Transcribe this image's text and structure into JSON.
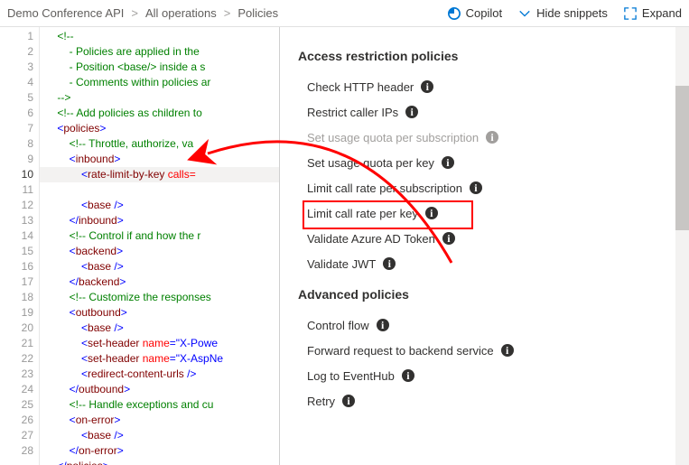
{
  "breadcrumb": {
    "a": "Demo Conference API",
    "b": "All operations",
    "c": "Policies",
    "sep": ">"
  },
  "actions": {
    "copilot": "Copilot",
    "hide": "Hide snippets",
    "expand": "Expand"
  },
  "code_lines": [
    {
      "n": "1",
      "indent": 1,
      "parts": [
        {
          "c": "t-cmt",
          "t": "<!--"
        }
      ]
    },
    {
      "n": "2",
      "indent": 2,
      "parts": [
        {
          "c": "t-cmt",
          "t": "- Policies are applied in the"
        }
      ]
    },
    {
      "n": "3",
      "indent": 2,
      "parts": [
        {
          "c": "t-cmt",
          "t": "- Position <base/> inside a s"
        }
      ]
    },
    {
      "n": "4",
      "indent": 2,
      "parts": [
        {
          "c": "t-cmt",
          "t": "- Comments within policies ar"
        }
      ]
    },
    {
      "n": "5",
      "indent": 1,
      "parts": [
        {
          "c": "t-cmt",
          "t": "-->"
        }
      ]
    },
    {
      "n": "6",
      "indent": 1,
      "parts": [
        {
          "c": "t-cmt",
          "t": "<!-- Add policies as children to"
        }
      ]
    },
    {
      "n": "7",
      "indent": 1,
      "parts": [
        {
          "c": "t-punc",
          "t": "<"
        },
        {
          "c": "t-tag",
          "t": "policies"
        },
        {
          "c": "t-punc",
          "t": ">"
        }
      ]
    },
    {
      "n": "8",
      "indent": 2,
      "parts": [
        {
          "c": "t-cmt",
          "t": "<!-- Throttle, authorize, va"
        }
      ]
    },
    {
      "n": "9",
      "indent": 2,
      "parts": [
        {
          "c": "t-punc",
          "t": "<"
        },
        {
          "c": "t-tag",
          "t": "inbound"
        },
        {
          "c": "t-punc",
          "t": ">"
        }
      ]
    },
    {
      "n": "10",
      "cur": true,
      "indent": 3,
      "parts": [
        {
          "c": "t-punc",
          "t": "<"
        },
        {
          "c": "t-tag",
          "t": "rate-limit-by-key"
        },
        {
          "c": "",
          "t": " "
        },
        {
          "c": "t-attr",
          "t": "calls="
        }
      ]
    },
    {
      "n": "11",
      "indent": 3,
      "parts": [
        {
          "c": "t-punc",
          "t": "<"
        },
        {
          "c": "t-tag",
          "t": "base"
        },
        {
          "c": "",
          "t": " "
        },
        {
          "c": "t-punc",
          "t": "/>"
        }
      ]
    },
    {
      "n": "12",
      "indent": 2,
      "parts": [
        {
          "c": "t-punc",
          "t": "</"
        },
        {
          "c": "t-tag",
          "t": "inbound"
        },
        {
          "c": "t-punc",
          "t": ">"
        }
      ]
    },
    {
      "n": "13",
      "indent": 2,
      "parts": [
        {
          "c": "t-cmt",
          "t": "<!-- Control if and how the r"
        }
      ]
    },
    {
      "n": "14",
      "indent": 2,
      "parts": [
        {
          "c": "t-punc",
          "t": "<"
        },
        {
          "c": "t-tag",
          "t": "backend"
        },
        {
          "c": "t-punc",
          "t": ">"
        }
      ]
    },
    {
      "n": "15",
      "indent": 3,
      "parts": [
        {
          "c": "t-punc",
          "t": "<"
        },
        {
          "c": "t-tag",
          "t": "base"
        },
        {
          "c": "",
          "t": " "
        },
        {
          "c": "t-punc",
          "t": "/>"
        }
      ]
    },
    {
      "n": "16",
      "indent": 2,
      "parts": [
        {
          "c": "t-punc",
          "t": "</"
        },
        {
          "c": "t-tag",
          "t": "backend"
        },
        {
          "c": "t-punc",
          "t": ">"
        }
      ]
    },
    {
      "n": "17",
      "indent": 2,
      "parts": [
        {
          "c": "t-cmt",
          "t": "<!-- Customize the responses"
        }
      ]
    },
    {
      "n": "18",
      "indent": 2,
      "parts": [
        {
          "c": "t-punc",
          "t": "<"
        },
        {
          "c": "t-tag",
          "t": "outbound"
        },
        {
          "c": "t-punc",
          "t": ">"
        }
      ]
    },
    {
      "n": "19",
      "indent": 3,
      "parts": [
        {
          "c": "t-punc",
          "t": "<"
        },
        {
          "c": "t-tag",
          "t": "base"
        },
        {
          "c": "",
          "t": " "
        },
        {
          "c": "t-punc",
          "t": "/>"
        }
      ]
    },
    {
      "n": "20",
      "indent": 3,
      "parts": [
        {
          "c": "t-punc",
          "t": "<"
        },
        {
          "c": "t-tag",
          "t": "set-header"
        },
        {
          "c": "",
          "t": " "
        },
        {
          "c": "t-attr",
          "t": "name"
        },
        {
          "c": "t-punc",
          "t": "="
        },
        {
          "c": "t-punc",
          "t": "\"X-Powe"
        }
      ]
    },
    {
      "n": "21",
      "indent": 3,
      "parts": [
        {
          "c": "t-punc",
          "t": "<"
        },
        {
          "c": "t-tag",
          "t": "set-header"
        },
        {
          "c": "",
          "t": " "
        },
        {
          "c": "t-attr",
          "t": "name"
        },
        {
          "c": "t-punc",
          "t": "="
        },
        {
          "c": "t-punc",
          "t": "\"X-AspNe"
        }
      ]
    },
    {
      "n": "22",
      "indent": 3,
      "parts": [
        {
          "c": "t-punc",
          "t": "<"
        },
        {
          "c": "t-tag",
          "t": "redirect-content-urls"
        },
        {
          "c": "",
          "t": " "
        },
        {
          "c": "t-punc",
          "t": "/>"
        }
      ]
    },
    {
      "n": "23",
      "indent": 2,
      "parts": [
        {
          "c": "t-punc",
          "t": "</"
        },
        {
          "c": "t-tag",
          "t": "outbound"
        },
        {
          "c": "t-punc",
          "t": ">"
        }
      ]
    },
    {
      "n": "24",
      "indent": 2,
      "parts": [
        {
          "c": "t-cmt",
          "t": "<!-- Handle exceptions and cu"
        }
      ]
    },
    {
      "n": "25",
      "indent": 2,
      "parts": [
        {
          "c": "t-punc",
          "t": "<"
        },
        {
          "c": "t-tag",
          "t": "on-error"
        },
        {
          "c": "t-punc",
          "t": ">"
        }
      ]
    },
    {
      "n": "26",
      "indent": 3,
      "parts": [
        {
          "c": "t-punc",
          "t": "<"
        },
        {
          "c": "t-tag",
          "t": "base"
        },
        {
          "c": "",
          "t": " "
        },
        {
          "c": "t-punc",
          "t": "/>"
        }
      ]
    },
    {
      "n": "27",
      "indent": 2,
      "parts": [
        {
          "c": "t-punc",
          "t": "</"
        },
        {
          "c": "t-tag",
          "t": "on-error"
        },
        {
          "c": "t-punc",
          "t": ">"
        }
      ]
    },
    {
      "n": "28",
      "indent": 1,
      "parts": [
        {
          "c": "t-punc",
          "t": "</"
        },
        {
          "c": "t-tag",
          "t": "policies"
        },
        {
          "c": "t-punc",
          "t": ">"
        }
      ]
    }
  ],
  "panel": {
    "group1_title": "Access restriction policies",
    "group1": [
      {
        "label": "Check HTTP header",
        "disabled": false
      },
      {
        "label": "Restrict caller IPs",
        "disabled": false
      },
      {
        "label": "Set usage quota per subscription",
        "disabled": true
      },
      {
        "label": "Set usage quota per key",
        "disabled": false
      },
      {
        "label": "Limit call rate per subscription",
        "disabled": false
      },
      {
        "label": "Limit call rate per key",
        "disabled": false,
        "highlight": true
      },
      {
        "label": "Validate Azure AD Token",
        "disabled": false
      },
      {
        "label": "Validate JWT",
        "disabled": false
      }
    ],
    "group2_title": "Advanced policies",
    "group2": [
      {
        "label": "Control flow",
        "disabled": false
      },
      {
        "label": "Forward request to backend service",
        "disabled": false
      },
      {
        "label": "Log to EventHub",
        "disabled": false
      },
      {
        "label": "Retry",
        "disabled": false
      }
    ]
  },
  "info_glyph": "i"
}
